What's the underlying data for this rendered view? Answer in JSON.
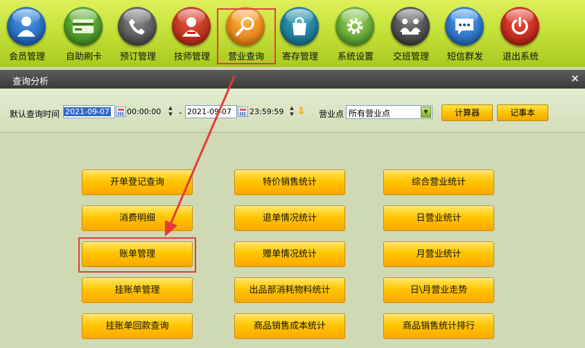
{
  "toolbar": {
    "items": [
      {
        "label": "会员管理",
        "icon": "member-icon"
      },
      {
        "label": "自助刷卡",
        "icon": "card-icon"
      },
      {
        "label": "预订管理",
        "icon": "phone-icon"
      },
      {
        "label": "技师管理",
        "icon": "technician-icon"
      },
      {
        "label": "营业查询",
        "icon": "search-icon"
      },
      {
        "label": "寄存管理",
        "icon": "bag-icon"
      },
      {
        "label": "系统设置",
        "icon": "gear-icon"
      },
      {
        "label": "交班管理",
        "icon": "shift-icon"
      },
      {
        "label": "短信群发",
        "icon": "message-icon"
      },
      {
        "label": "退出系统",
        "icon": "power-icon"
      }
    ]
  },
  "window": {
    "title": "查询分析",
    "close": "×"
  },
  "query": {
    "time_label": "默认查询时间",
    "start_date": "2021-09-07",
    "start_time": "00:00:00",
    "separator": "-",
    "end_date": "2021-09-07",
    "end_time": "23:59:59",
    "outlet_label": "营业点",
    "outlet_value": "所有营业点",
    "calculator": "计算器",
    "notepad": "记事本"
  },
  "buttons": {
    "col1": [
      "开单登记查询",
      "消费明细",
      "账单管理",
      "挂账单管理",
      "挂账单回款查询"
    ],
    "col2": [
      "特价销售统计",
      "退单情况统计",
      "赠单情况统计",
      "出品部消耗物料统计",
      "商品销售成本统计"
    ],
    "col3": [
      "综合营业统计",
      "日营业统计",
      "月营业统计",
      "日\\月营业走势",
      "商品销售统计排行"
    ]
  },
  "colors": {
    "highlight": "#e53a3a",
    "button": "#ffc600",
    "toolbar": "#c6e23a"
  }
}
